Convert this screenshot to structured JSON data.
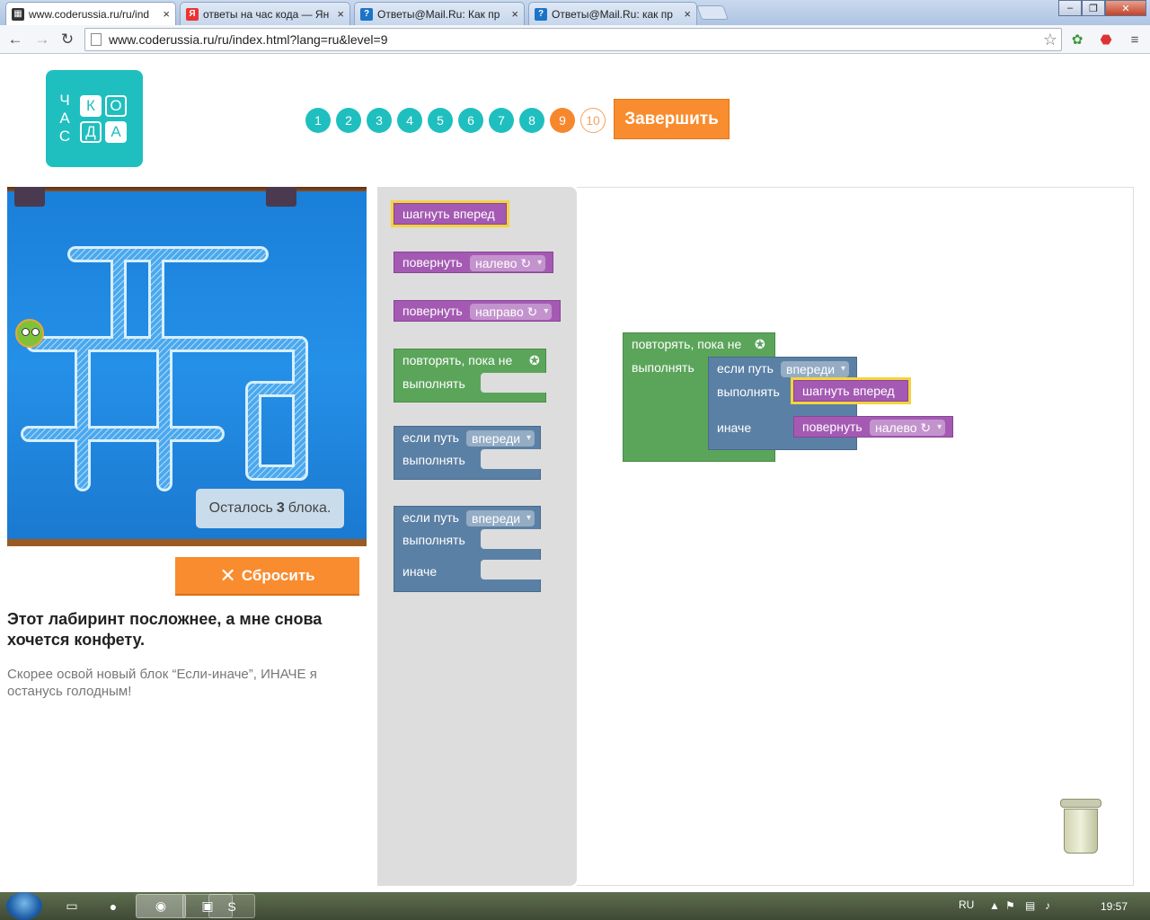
{
  "browser": {
    "tabs": [
      {
        "title": "www.coderussia.ru/ru/ind",
        "favicon": "grid-icon",
        "active": true
      },
      {
        "title": "ответы на час кода — Ян",
        "favicon": "yandex-icon",
        "active": false
      },
      {
        "title": "Ответы@Mail.Ru: Как пр",
        "favicon": "question-icon",
        "active": false
      },
      {
        "title": "Ответы@Mail.Ru: как пр",
        "favicon": "question-icon",
        "active": false
      }
    ],
    "url": "www.coderussia.ru/ru/index.html?lang=ru&level=9"
  },
  "logo": {
    "vertical": [
      "Ч",
      "А",
      "С"
    ],
    "cells": [
      "К",
      "О",
      "Д",
      "А"
    ]
  },
  "levels": {
    "items": [
      "1",
      "2",
      "3",
      "4",
      "5",
      "6",
      "7",
      "8",
      "9",
      "10"
    ],
    "current": "9",
    "finish_label": "Завершить"
  },
  "maze": {
    "remaining_prefix": "Осталось",
    "remaining_count": "3",
    "remaining_suffix": "блока."
  },
  "left": {
    "reset_label": "Сбросить",
    "title": "Этот лабиринт посложнее, а мне снова хочется конфету.",
    "description": "Скорее освой новый блок “Если-иначе”, ИНАЧЕ я останусь голодным!"
  },
  "toolbox": {
    "move_forward": "шагнуть вперед",
    "turn1": {
      "label": "повернуть",
      "value": "налево ↻"
    },
    "turn2": {
      "label": "повернуть",
      "value": "направо ↻"
    },
    "repeat": {
      "label": "повторять, пока не",
      "do": "выполнять"
    },
    "if1": {
      "label": "если путь",
      "value": "впереди",
      "do": "выполнять"
    },
    "if2": {
      "label": "если путь",
      "value": "впереди",
      "do": "выполнять",
      "else": "иначе"
    }
  },
  "workspace": {
    "repeat": {
      "label": "повторять, пока не",
      "do": "выполнять"
    },
    "if": {
      "label": "если путь",
      "value": "впереди",
      "do": "выполнять",
      "else": "иначе"
    },
    "move_forward": "шагнуть вперед",
    "turn": {
      "label": "повернуть",
      "value": "налево ↻"
    }
  },
  "taskbar": {
    "lang": "RU",
    "time": "19:57"
  },
  "colors": {
    "teal": "#1fbfbf",
    "orange": "#f98c2f",
    "purple": "#a45ab3",
    "green": "#5ba55b",
    "blue": "#5b80a5"
  }
}
